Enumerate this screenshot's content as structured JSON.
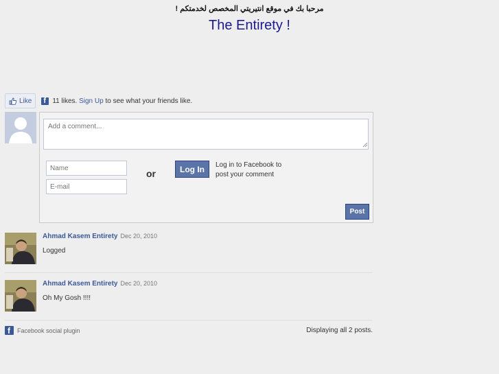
{
  "header": {
    "welcome": "مرحبا بك في موقع انتيريتي المخصص لخدمتكم !",
    "title": "The Entirety !"
  },
  "like_bar": {
    "like_label": "Like",
    "count_text": "11 likes.",
    "signup_link": "Sign Up",
    "suffix_text": "to see what your friends like."
  },
  "comment_form": {
    "placeholder": "Add a comment...",
    "name_placeholder": "Name",
    "email_placeholder": "E-mail",
    "or_text": "or",
    "login_label": "Log In",
    "login_note": "Log in to Facebook to post your comment",
    "post_label": "Post"
  },
  "posts": [
    {
      "author": "Ahmad Kasem Entirety",
      "date": "Dec 20, 2010",
      "text": "Logged"
    },
    {
      "author": "Ahmad Kasem Entirety",
      "date": "Dec 20, 2010",
      "text": "Oh My Gosh !!!!"
    }
  ],
  "footer": {
    "plugin_label": "Facebook social plugin",
    "count_text": "Displaying all 2 posts."
  },
  "colors": {
    "facebook_blue": "#3b5998",
    "button_blue": "#5b74a8",
    "title_blue": "#1a1a8c",
    "background": "#eeeeee"
  },
  "icons": [
    "thumbs-up-icon",
    "facebook-icon",
    "default-avatar-icon",
    "resize-grip-icon"
  ]
}
